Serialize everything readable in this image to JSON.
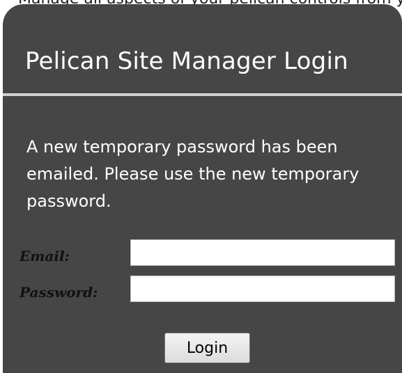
{
  "top_strip": {
    "text": "Manage all aspects of your pelican controls from your computer, tablet or smartphone"
  },
  "login": {
    "title": "Pelican Site Manager Login",
    "message": "A new temporary password has been emailed. Please use the new temporary password.",
    "email_label": "Email:",
    "email_value": "",
    "password_label": "Password:",
    "password_value": "",
    "login_button_label": "Login"
  },
  "colors": {
    "panel_background": "#464646",
    "divider": "#d2d2d2",
    "title_text": "#ffffff",
    "label_text": "#111111"
  }
}
